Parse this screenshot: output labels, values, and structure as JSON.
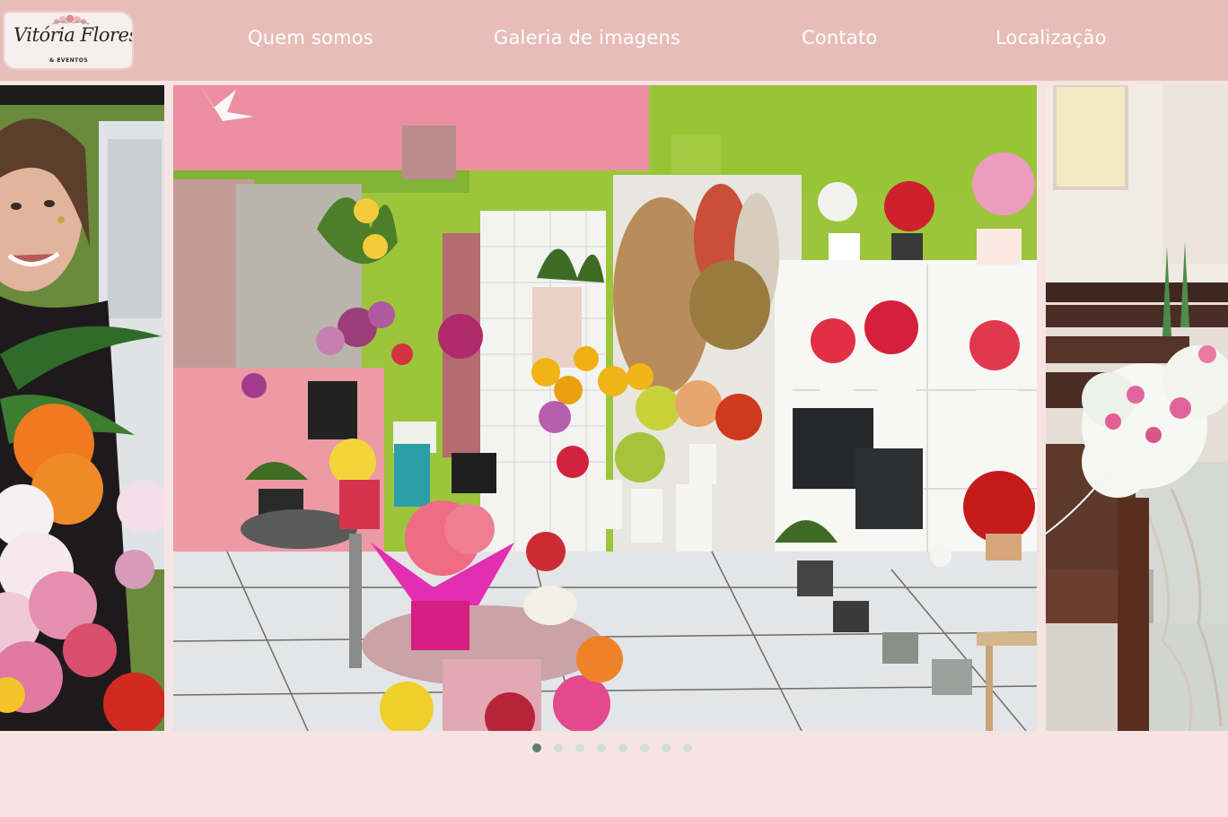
{
  "logo": {
    "script_text": "Vitória Flores",
    "sub_text": "& EVENTOS"
  },
  "nav": {
    "items": [
      {
        "label": "Quem somos"
      },
      {
        "label": "Galeria de imagens"
      },
      {
        "label": "Contato"
      },
      {
        "label": "Localização"
      }
    ]
  },
  "gallery": {
    "slides": [
      {
        "image": "woman-with-flower-bouquet-photo"
      },
      {
        "image": "flower-shop-interior-photo"
      },
      {
        "image": "church-flower-arrangement-photo"
      }
    ],
    "pagination": {
      "total": 8,
      "active_index": 0,
      "active_color": "#5f7c7a",
      "inactive_color": "#d3dcdc"
    }
  },
  "colors": {
    "header_bg": "#e7bdb9",
    "page_bg": "#f6e4e3",
    "nav_text": "#ffffff"
  }
}
